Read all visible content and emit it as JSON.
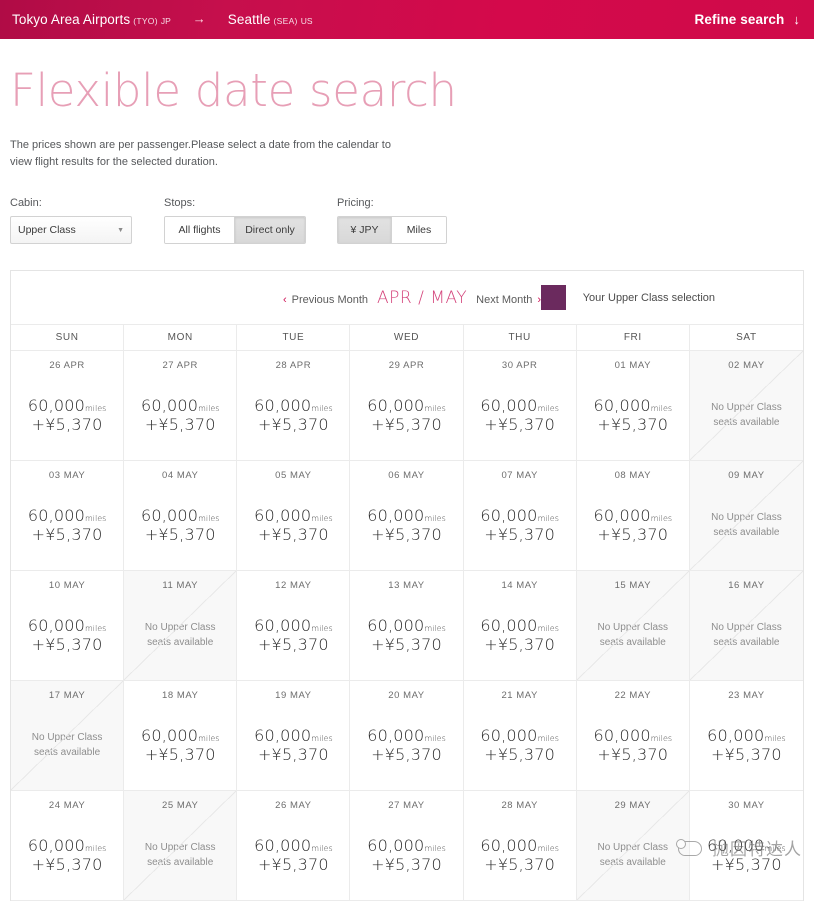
{
  "header": {
    "origin_city": "Tokyo Area Airports",
    "origin_code": "(TYO)",
    "origin_country": "JP",
    "arrow": "→",
    "dest_city": "Seattle",
    "dest_code": "(SEA)",
    "dest_country": "US",
    "refine_label": "Refine search",
    "refine_arrow": "↓",
    "gradient_start": "#b00c46",
    "gradient_end": "#d4094b"
  },
  "page": {
    "title": "Flexible date search",
    "title_color": "#e79fb6",
    "description": "The prices shown are per passenger.Please select a date from the calendar to view flight results for the selected duration."
  },
  "filters": {
    "cabin": {
      "label": "Cabin:",
      "value": "Upper Class",
      "caret": "▼",
      "options": [
        "Upper Class"
      ]
    },
    "stops": {
      "label": "Stops:",
      "options": [
        {
          "label": "All flights",
          "active": false
        },
        {
          "label": "Direct only",
          "active": true
        }
      ]
    },
    "pricing": {
      "label": "Pricing:",
      "options": [
        {
          "label": "¥ JPY",
          "active": true
        },
        {
          "label": "Miles",
          "active": false
        }
      ]
    }
  },
  "calendar": {
    "prev_chevron": "‹",
    "prev_label": "Previous Month",
    "months": "APR / MAY",
    "next_label": "Next Month",
    "next_chevron": "›",
    "legend": {
      "color": "#6b2a5e",
      "text": "Your Upper Class selection"
    },
    "day_headers": [
      "SUN",
      "MON",
      "TUE",
      "WED",
      "THU",
      "FRI",
      "SAT"
    ],
    "unavailable_text_line1": "No Upper Class",
    "unavailable_text_line2": "seats available",
    "miles_unit": "miles",
    "weeks": [
      [
        {
          "date": "26 APR",
          "miles": "60,000",
          "cash": "+¥5,370",
          "available": true
        },
        {
          "date": "27 APR",
          "miles": "60,000",
          "cash": "+¥5,370",
          "available": true
        },
        {
          "date": "28 APR",
          "miles": "60,000",
          "cash": "+¥5,370",
          "available": true
        },
        {
          "date": "29 APR",
          "miles": "60,000",
          "cash": "+¥5,370",
          "available": true
        },
        {
          "date": "30 APR",
          "miles": "60,000",
          "cash": "+¥5,370",
          "available": true
        },
        {
          "date": "01 MAY",
          "miles": "60,000",
          "cash": "+¥5,370",
          "available": true
        },
        {
          "date": "02 MAY",
          "miles": "",
          "cash": "",
          "available": false
        }
      ],
      [
        {
          "date": "03 MAY",
          "miles": "60,000",
          "cash": "+¥5,370",
          "available": true
        },
        {
          "date": "04 MAY",
          "miles": "60,000",
          "cash": "+¥5,370",
          "available": true
        },
        {
          "date": "05 MAY",
          "miles": "60,000",
          "cash": "+¥5,370",
          "available": true
        },
        {
          "date": "06 MAY",
          "miles": "60,000",
          "cash": "+¥5,370",
          "available": true
        },
        {
          "date": "07 MAY",
          "miles": "60,000",
          "cash": "+¥5,370",
          "available": true
        },
        {
          "date": "08 MAY",
          "miles": "60,000",
          "cash": "+¥5,370",
          "available": true
        },
        {
          "date": "09 MAY",
          "miles": "",
          "cash": "",
          "available": false
        }
      ],
      [
        {
          "date": "10 MAY",
          "miles": "60,000",
          "cash": "+¥5,370",
          "available": true
        },
        {
          "date": "11 MAY",
          "miles": "",
          "cash": "",
          "available": false
        },
        {
          "date": "12 MAY",
          "miles": "60,000",
          "cash": "+¥5,370",
          "available": true
        },
        {
          "date": "13 MAY",
          "miles": "60,000",
          "cash": "+¥5,370",
          "available": true
        },
        {
          "date": "14 MAY",
          "miles": "60,000",
          "cash": "+¥5,370",
          "available": true
        },
        {
          "date": "15 MAY",
          "miles": "",
          "cash": "",
          "available": false
        },
        {
          "date": "16 MAY",
          "miles": "",
          "cash": "",
          "available": false
        }
      ],
      [
        {
          "date": "17 MAY",
          "miles": "",
          "cash": "",
          "available": false
        },
        {
          "date": "18 MAY",
          "miles": "60,000",
          "cash": "+¥5,370",
          "available": true
        },
        {
          "date": "19 MAY",
          "miles": "60,000",
          "cash": "+¥5,370",
          "available": true
        },
        {
          "date": "20 MAY",
          "miles": "60,000",
          "cash": "+¥5,370",
          "available": true
        },
        {
          "date": "21 MAY",
          "miles": "60,000",
          "cash": "+¥5,370",
          "available": true
        },
        {
          "date": "22 MAY",
          "miles": "60,000",
          "cash": "+¥5,370",
          "available": true
        },
        {
          "date": "23 MAY",
          "miles": "60,000",
          "cash": "+¥5,370",
          "available": true
        }
      ],
      [
        {
          "date": "24 MAY",
          "miles": "60,000",
          "cash": "+¥5,370",
          "available": true
        },
        {
          "date": "25 MAY",
          "miles": "",
          "cash": "",
          "available": false
        },
        {
          "date": "26 MAY",
          "miles": "60,000",
          "cash": "+¥5,370",
          "available": true
        },
        {
          "date": "27 MAY",
          "miles": "60,000",
          "cash": "+¥5,370",
          "available": true
        },
        {
          "date": "28 MAY",
          "miles": "60,000",
          "cash": "+¥5,370",
          "available": true
        },
        {
          "date": "29 MAY",
          "miles": "",
          "cash": "",
          "available": false
        },
        {
          "date": "30 MAY",
          "miles": "60,000",
          "cash": "+¥5,370",
          "available": true
        }
      ]
    ]
  },
  "watermark": {
    "text": "抛因特达人"
  }
}
